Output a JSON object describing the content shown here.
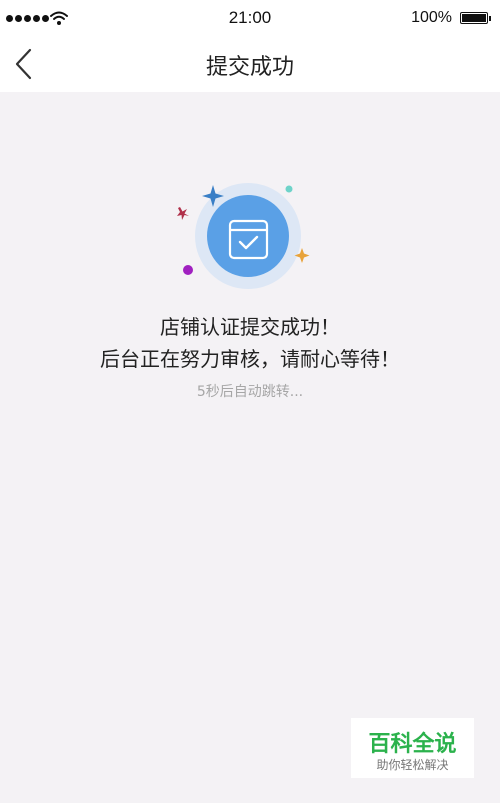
{
  "status_bar": {
    "time": "21:00",
    "battery": "100%"
  },
  "nav": {
    "title": "提交成功",
    "back_icon": "chevron-left-icon"
  },
  "illustration": {
    "icon": "check-calendar-icon",
    "accent": "#5aa0e6",
    "halo": "#dde7f5",
    "decor_colors": [
      "#3a7fc6",
      "#b0304a",
      "#6ed3c9",
      "#e8a33a",
      "#a020c0"
    ]
  },
  "message": {
    "line1": "店铺认证提交成功！",
    "line2": "后台正在努力审核，请耐心等待！",
    "countdown": "5秒后自动跳转..."
  },
  "watermark": {
    "title": "百科全说",
    "subtitle": "助你轻松解决"
  }
}
